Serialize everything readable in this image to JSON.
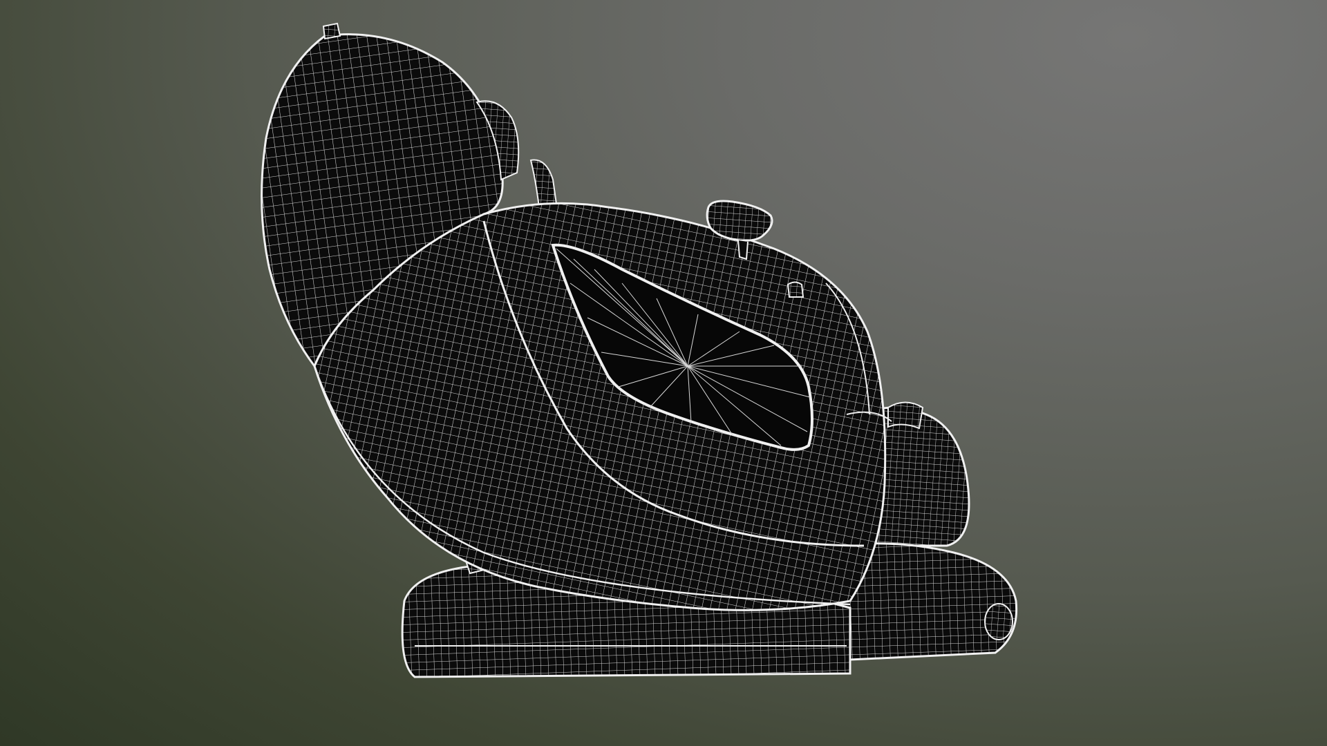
{
  "scene": {
    "subject": "massage-chair-wireframe",
    "render_mode": "wireframe",
    "colors": {
      "background_top": "#767675",
      "background_bottom": "#2f3826",
      "mesh_fill": "#0b0b0b",
      "wire": "#e6e6e6"
    }
  }
}
